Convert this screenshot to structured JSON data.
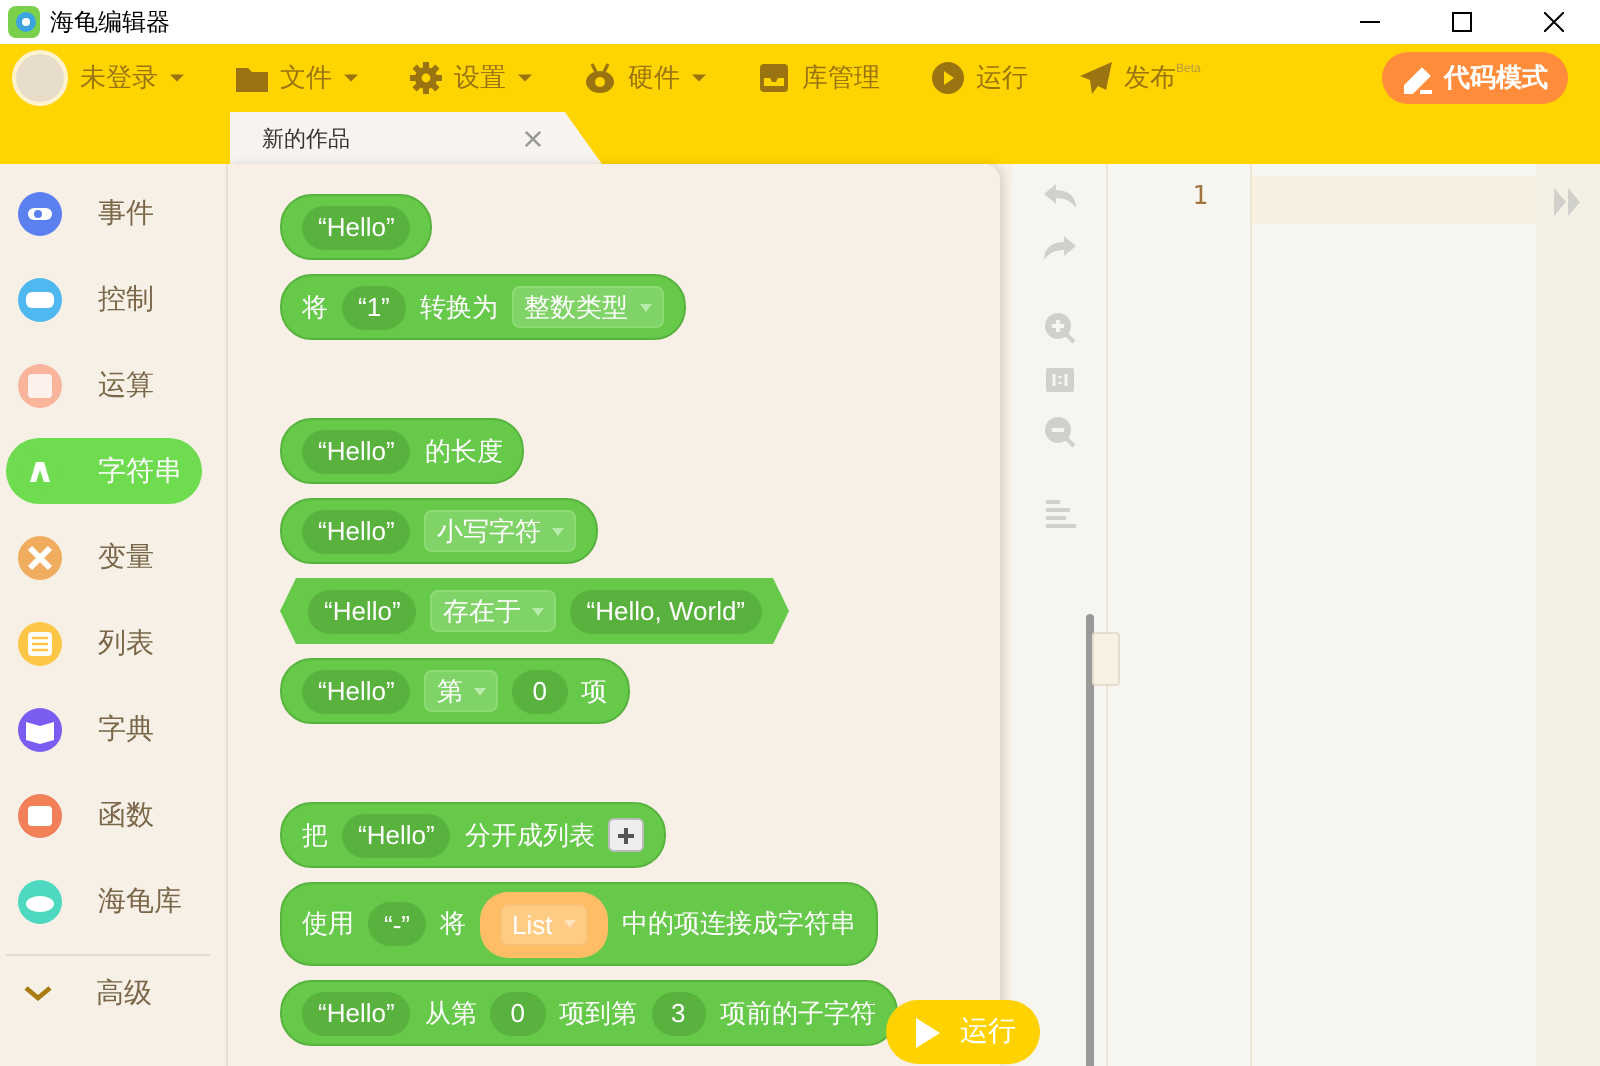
{
  "window": {
    "title": "海龟编辑器"
  },
  "toolbar": {
    "user": {
      "label": "未登录",
      "dropdown": true
    },
    "items": [
      {
        "kind": "folder",
        "label": "文件",
        "dropdown": true
      },
      {
        "kind": "gear",
        "label": "设置",
        "dropdown": true
      },
      {
        "kind": "robot",
        "label": "硬件",
        "dropdown": true
      },
      {
        "kind": "box",
        "label": "库管理",
        "dropdown": false
      },
      {
        "kind": "play",
        "label": "运行",
        "dropdown": false
      },
      {
        "kind": "send",
        "label": "发布",
        "badge": "Beta",
        "dropdown": false
      }
    ],
    "code_mode_button": "代码模式"
  },
  "tabs": [
    {
      "label": "新的作品",
      "selected": true
    }
  ],
  "categories": [
    {
      "label": "事件",
      "color": "#5b80f0",
      "selected": false
    },
    {
      "label": "控制",
      "color": "#4fb8f0",
      "selected": false
    },
    {
      "label": "运算",
      "color": "#f9b49c",
      "selected": false
    },
    {
      "label": "字符串",
      "color": "#6fdc50",
      "selected": true
    },
    {
      "label": "变量",
      "color": "#f1ad5f",
      "selected": false
    },
    {
      "label": "列表",
      "color": "#fdc647",
      "selected": false
    },
    {
      "label": "字典",
      "color": "#7a5cf0",
      "selected": false
    },
    {
      "label": "函数",
      "color": "#f28059",
      "selected": false
    },
    {
      "label": "海龟库",
      "color": "#4dd9c0",
      "selected": false
    }
  ],
  "advanced": {
    "label": "高级"
  },
  "block_groups": [
    [
      {
        "kind": "round",
        "parts": [
          {
            "kind": "string",
            "text": "“Hello”"
          }
        ]
      },
      {
        "kind": "round",
        "parts": [
          {
            "kind": "text",
            "text": "将"
          },
          {
            "kind": "string",
            "text": "“1”"
          },
          {
            "kind": "text",
            "text": "转换为"
          },
          {
            "kind": "dropdown",
            "text": "整数类型"
          }
        ]
      }
    ],
    [
      {
        "kind": "round",
        "parts": [
          {
            "kind": "string",
            "text": "“Hello”"
          },
          {
            "kind": "text",
            "text": "的长度"
          }
        ]
      },
      {
        "kind": "round",
        "parts": [
          {
            "kind": "string",
            "text": "“Hello”"
          },
          {
            "kind": "dropdown",
            "text": "小写字符"
          }
        ]
      },
      {
        "kind": "hex",
        "parts": [
          {
            "kind": "string",
            "text": "“Hello”"
          },
          {
            "kind": "dropdown",
            "text": "存在于"
          },
          {
            "kind": "string",
            "text": "“Hello, World”"
          }
        ]
      },
      {
        "kind": "round",
        "parts": [
          {
            "kind": "string",
            "text": "“Hello”"
          },
          {
            "kind": "dropdown",
            "text": "第"
          },
          {
            "kind": "number",
            "text": "0"
          },
          {
            "kind": "text",
            "text": "项"
          }
        ]
      }
    ],
    [
      {
        "kind": "round",
        "parts": [
          {
            "kind": "text",
            "text": "把"
          },
          {
            "kind": "string",
            "text": "“Hello”"
          },
          {
            "kind": "text",
            "text": "分开成列表"
          },
          {
            "kind": "plus"
          }
        ]
      },
      {
        "kind": "round",
        "parts": [
          {
            "kind": "text",
            "text": "使用"
          },
          {
            "kind": "string",
            "text": "“-”"
          },
          {
            "kind": "text",
            "text": "将"
          },
          {
            "kind": "list",
            "text": "List"
          },
          {
            "kind": "text",
            "text": "中的项连接成字符串"
          }
        ]
      },
      {
        "kind": "round",
        "parts": [
          {
            "kind": "string",
            "text": "“Hello”"
          },
          {
            "kind": "text",
            "text": "从第"
          },
          {
            "kind": "number",
            "text": "0"
          },
          {
            "kind": "text",
            "text": "项到第"
          },
          {
            "kind": "number",
            "text": "3"
          },
          {
            "kind": "text",
            "text": "项前的子字符"
          }
        ]
      }
    ]
  ],
  "editor": {
    "line_numbers": [
      "1"
    ]
  },
  "run_button": "运行"
}
